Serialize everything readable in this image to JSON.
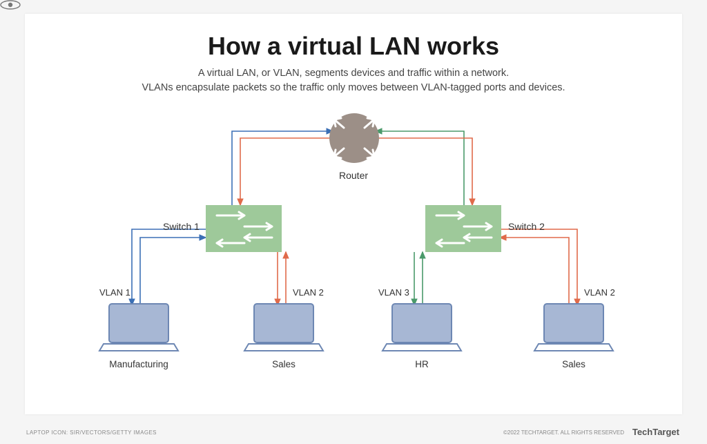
{
  "title": "How a virtual LAN works",
  "subtitle_line1": "A virtual LAN, or VLAN, segments devices and traffic within a network.",
  "subtitle_line2": "VLANs encapsulate packets so the traffic only moves between VLAN-tagged ports and devices.",
  "router_label": "Router",
  "switches": {
    "s1": "Switch 1",
    "s2": "Switch 2"
  },
  "vlans": {
    "v1": "VLAN 1",
    "v2a": "VLAN 2",
    "v3": "VLAN 3",
    "v2b": "VLAN 2"
  },
  "devices": {
    "d1": "Manufacturing",
    "d2": "Sales",
    "d3": "HR",
    "d4": "Sales"
  },
  "colors": {
    "vlan1": "#3b6fb5",
    "vlan2": "#e06a4a",
    "vlan3": "#4a9a6a",
    "router_fill": "#9c8f87",
    "switch_fill": "#9ec99a",
    "laptop_stroke": "#6d87b3",
    "laptop_fill": "#a7b7d4"
  },
  "credits": "LAPTOP ICON: SIR/VECTORS/GETTY IMAGES",
  "copyright": "©2022 TECHTARGET. ALL RIGHTS RESERVED",
  "brand": "TechTarget"
}
